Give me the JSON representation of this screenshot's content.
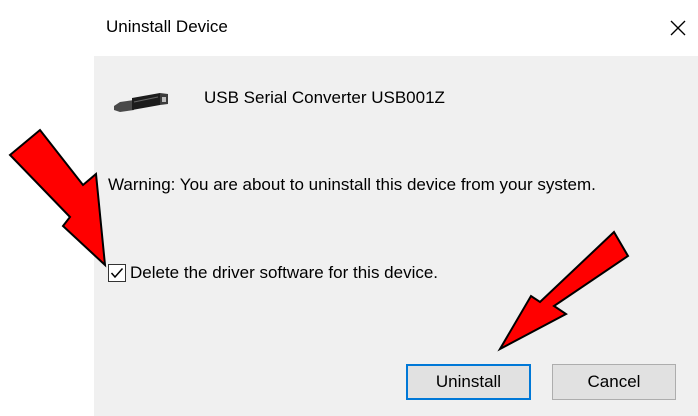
{
  "dialog": {
    "title": "Uninstall Device",
    "close_icon": "close-icon",
    "device_icon": "usb-cable-icon",
    "device_name": "USB Serial Converter USB001Z",
    "warning": "Warning: You are about to uninstall this device from your system.",
    "checkbox": {
      "label": "Delete the driver software for this device.",
      "checked": true
    },
    "buttons": {
      "uninstall_label": "Uninstall",
      "cancel_label": "Cancel"
    }
  },
  "annotations": {
    "arrow_color": "#ff0000",
    "arrows": [
      "red-arrow-to-checkbox",
      "red-arrow-to-uninstall"
    ]
  },
  "colors": {
    "dialog_body": "#f0f0f0",
    "default_button_border": "#0078d7"
  }
}
